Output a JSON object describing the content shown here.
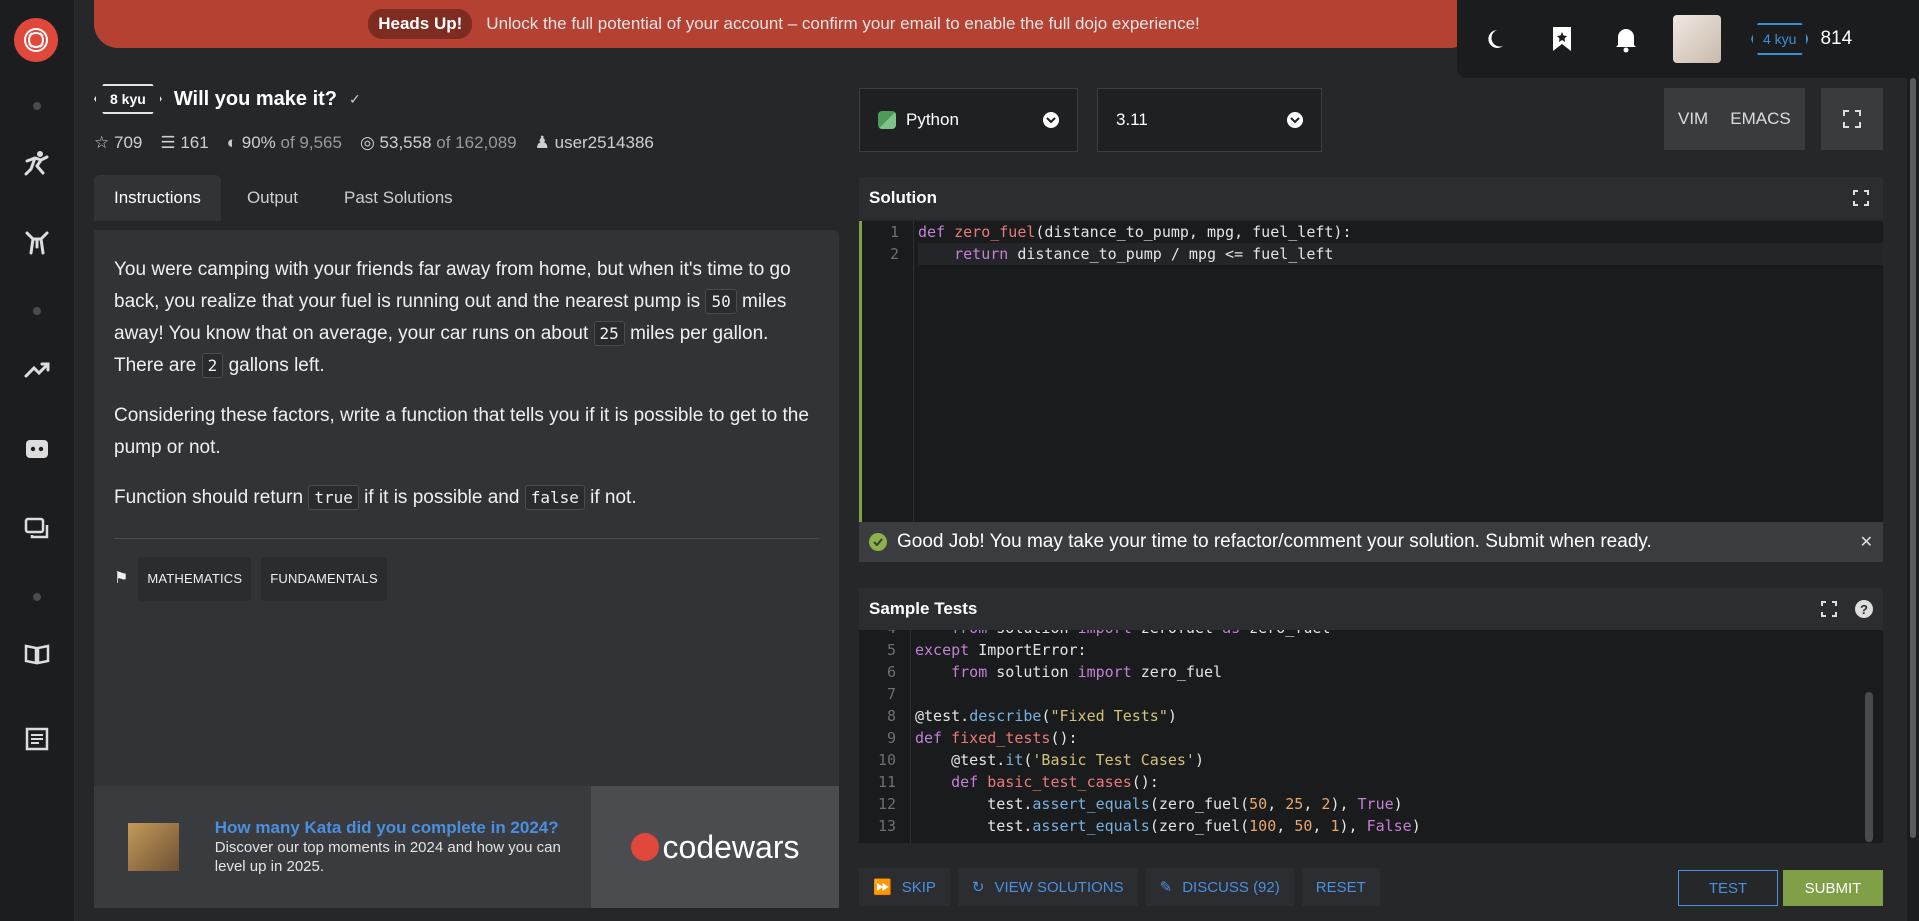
{
  "banner": {
    "pill": "Heads Up!",
    "message": "Unlock the full potential of your account – confirm your email to enable the full dojo experience!"
  },
  "user": {
    "rank": "4 kyu",
    "honor": "814"
  },
  "kata": {
    "rank": "8 kyu",
    "title": "Will you make it?",
    "stars": "709",
    "collections": "161",
    "satisfaction": "90%",
    "satisfaction_of": "of 9,565",
    "completed": "53,558",
    "completed_of": "of 162,089",
    "author": "user2514386"
  },
  "tabs": [
    "Instructions",
    "Output",
    "Past Solutions"
  ],
  "instructions": {
    "p1_a": "You were camping with your friends far away from home, but when it's time to go back, you realize that your fuel is running out and the nearest pump is ",
    "p1_code1": "50",
    "p1_b": " miles away! You know that on average, your car runs on about ",
    "p1_code2": "25",
    "p1_c": " miles per gallon. There are ",
    "p1_code3": "2",
    "p1_d": " gallons left.",
    "p2": "Considering these factors, write a function that tells you if it is possible to get to the pump or not.",
    "p3_a": "Function should return ",
    "p3_code1": "true",
    "p3_b": " if it is possible and ",
    "p3_code2": "false",
    "p3_c": " if not."
  },
  "tags": [
    "MATHEMATICS",
    "FUNDAMENTALS"
  ],
  "promo": {
    "title": "How many Kata did you complete in 2024?",
    "body": "Discover our top moments in 2024 and how you can level up in 2025.",
    "brand": "codewars"
  },
  "editor": {
    "language": "Python",
    "version": "3.11",
    "modes": [
      "VIM",
      "EMACS"
    ],
    "solution_title": "Solution",
    "good_job": "Good Job! You may take your time to refactor/comment your solution. Submit when ready.",
    "tests_title": "Sample Tests"
  },
  "actions": {
    "skip": "SKIP",
    "view_solutions": "VIEW SOLUTIONS",
    "discuss": "DISCUSS (92)",
    "reset": "RESET",
    "test": "TEST",
    "submit": "SUBMIT"
  },
  "colors": {
    "accent_red": "#b44131",
    "link_blue": "#4a8fe0",
    "submit_green": "#7fa047"
  }
}
